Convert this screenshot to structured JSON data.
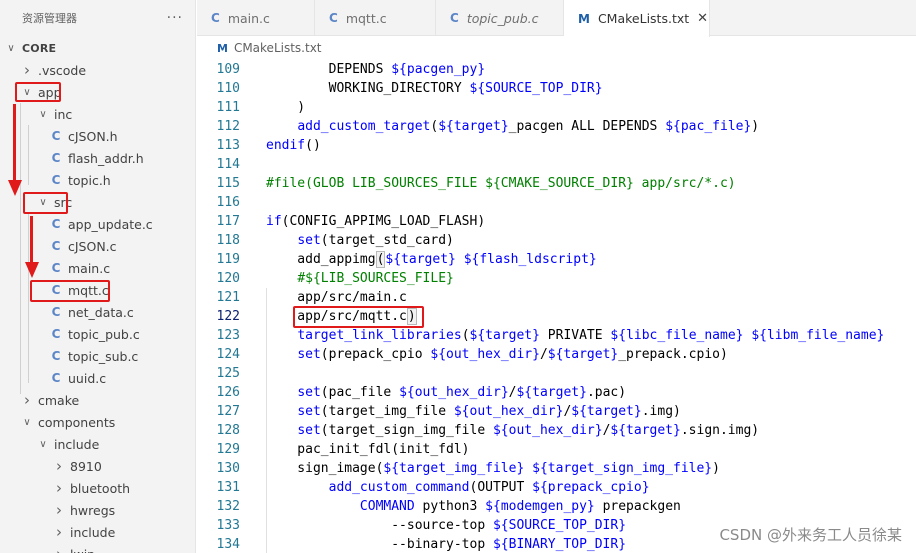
{
  "sidebar": {
    "title": "资源管理器",
    "more": "···",
    "tree": [
      {
        "label": "CORE",
        "kind": "folder-open",
        "depth": 0,
        "bold": true
      },
      {
        "label": ".vscode",
        "kind": "folder",
        "depth": 1
      },
      {
        "label": "app",
        "kind": "folder-open",
        "depth": 1
      },
      {
        "label": "inc",
        "kind": "folder-open",
        "depth": 2
      },
      {
        "label": "cJSON.h",
        "kind": "file",
        "depth": 3
      },
      {
        "label": "flash_addr.h",
        "kind": "file",
        "depth": 3
      },
      {
        "label": "topic.h",
        "kind": "file",
        "depth": 3
      },
      {
        "label": "src",
        "kind": "folder-open",
        "depth": 2
      },
      {
        "label": "app_update.c",
        "kind": "file",
        "depth": 3
      },
      {
        "label": "cJSON.c",
        "kind": "file",
        "depth": 3
      },
      {
        "label": "main.c",
        "kind": "file",
        "depth": 3
      },
      {
        "label": "mqtt.c",
        "kind": "file",
        "depth": 3
      },
      {
        "label": "net_data.c",
        "kind": "file",
        "depth": 3
      },
      {
        "label": "topic_pub.c",
        "kind": "file",
        "depth": 3
      },
      {
        "label": "topic_sub.c",
        "kind": "file",
        "depth": 3
      },
      {
        "label": "uuid.c",
        "kind": "file",
        "depth": 3
      },
      {
        "label": "cmake",
        "kind": "folder",
        "depth": 1
      },
      {
        "label": "components",
        "kind": "folder-open",
        "depth": 1
      },
      {
        "label": "include",
        "kind": "folder-open",
        "depth": 2
      },
      {
        "label": "8910",
        "kind": "folder",
        "depth": 3
      },
      {
        "label": "bluetooth",
        "kind": "folder",
        "depth": 3
      },
      {
        "label": "hwregs",
        "kind": "folder",
        "depth": 3
      },
      {
        "label": "include",
        "kind": "folder",
        "depth": 3
      },
      {
        "label": "lwip",
        "kind": "folder",
        "depth": 3
      }
    ]
  },
  "tabs": [
    {
      "label": "main.c",
      "icon": "C",
      "active": false,
      "italic": false
    },
    {
      "label": "mqtt.c",
      "icon": "C",
      "active": false,
      "italic": false
    },
    {
      "label": "topic_pub.c",
      "icon": "C",
      "active": false,
      "italic": true
    },
    {
      "label": "CMakeLists.txt",
      "icon": "M",
      "active": true,
      "italic": false,
      "close": "✕"
    }
  ],
  "breadcrumb": {
    "icon": "M",
    "label": "CMakeLists.txt"
  },
  "current_line": 122,
  "code": [
    {
      "n": 109,
      "segs": [
        [
          "pl",
          "        DEPENDS "
        ],
        [
          "var",
          "${pacgen_py}"
        ]
      ]
    },
    {
      "n": 110,
      "segs": [
        [
          "pl",
          "        WORKING_DIRECTORY "
        ],
        [
          "var",
          "${SOURCE_TOP_DIR}"
        ]
      ]
    },
    {
      "n": 111,
      "segs": [
        [
          "pl",
          "    )"
        ]
      ]
    },
    {
      "n": 112,
      "segs": [
        [
          "pl",
          "    "
        ],
        [
          "fn",
          "add_custom_target"
        ],
        [
          "pl",
          "("
        ],
        [
          "var",
          "${target}"
        ],
        [
          "pl",
          "_pacgen ALL DEPENDS "
        ],
        [
          "var",
          "${pac_file}"
        ],
        [
          "pl",
          ")"
        ]
      ]
    },
    {
      "n": 113,
      "segs": [
        [
          "fn",
          "endif"
        ],
        [
          "pl",
          "()"
        ]
      ]
    },
    {
      "n": 114,
      "segs": []
    },
    {
      "n": 115,
      "segs": [
        [
          "cm",
          "#file(GLOB LIB_SOURCES_FILE ${CMAKE_SOURCE_DIR} app/src/*.c)"
        ]
      ]
    },
    {
      "n": 116,
      "segs": []
    },
    {
      "n": 117,
      "segs": [
        [
          "fn",
          "if"
        ],
        [
          "pl",
          "(CONFIG_APPIMG_LOAD_FLASH)"
        ]
      ]
    },
    {
      "n": 118,
      "segs": [
        [
          "pl",
          "    "
        ],
        [
          "fn",
          "set"
        ],
        [
          "pl",
          "(target_std_card)"
        ]
      ]
    },
    {
      "n": 119,
      "segs": [
        [
          "pl",
          "    add_appimg"
        ],
        [
          "match",
          "("
        ],
        [
          "var",
          "${target}"
        ],
        [
          "pl",
          " "
        ],
        [
          "var",
          "${flash_ldscript}"
        ]
      ]
    },
    {
      "n": 120,
      "segs": [
        [
          "pl",
          "    "
        ],
        [
          "cm",
          "#${LIB_SOURCES_FILE}"
        ]
      ]
    },
    {
      "n": 121,
      "segs": [
        [
          "pl",
          "    app/src/main.c"
        ]
      ]
    },
    {
      "n": 122,
      "segs": [
        [
          "pl",
          "    app/src/mqtt.c"
        ],
        [
          "match",
          ")"
        ]
      ]
    },
    {
      "n": 123,
      "segs": [
        [
          "pl",
          "    "
        ],
        [
          "fn",
          "target_link_libraries"
        ],
        [
          "pl",
          "("
        ],
        [
          "var",
          "${target}"
        ],
        [
          "pl",
          " PRIVATE "
        ],
        [
          "var",
          "${libc_file_name}"
        ],
        [
          "pl",
          " "
        ],
        [
          "var",
          "${libm_file_name}"
        ]
      ]
    },
    {
      "n": 124,
      "segs": [
        [
          "pl",
          "    "
        ],
        [
          "fn",
          "set"
        ],
        [
          "pl",
          "(prepack_cpio "
        ],
        [
          "var",
          "${out_hex_dir}"
        ],
        [
          "pl",
          "/"
        ],
        [
          "var",
          "${target}"
        ],
        [
          "pl",
          "_prepack.cpio)"
        ]
      ]
    },
    {
      "n": 125,
      "segs": []
    },
    {
      "n": 126,
      "segs": [
        [
          "pl",
          "    "
        ],
        [
          "fn",
          "set"
        ],
        [
          "pl",
          "(pac_file "
        ],
        [
          "var",
          "${out_hex_dir}"
        ],
        [
          "pl",
          "/"
        ],
        [
          "var",
          "${target}"
        ],
        [
          "pl",
          ".pac)"
        ]
      ]
    },
    {
      "n": 127,
      "segs": [
        [
          "pl",
          "    "
        ],
        [
          "fn",
          "set"
        ],
        [
          "pl",
          "(target_img_file "
        ],
        [
          "var",
          "${out_hex_dir}"
        ],
        [
          "pl",
          "/"
        ],
        [
          "var",
          "${target}"
        ],
        [
          "pl",
          ".img)"
        ]
      ]
    },
    {
      "n": 128,
      "segs": [
        [
          "pl",
          "    "
        ],
        [
          "fn",
          "set"
        ],
        [
          "pl",
          "(target_sign_img_file "
        ],
        [
          "var",
          "${out_hex_dir}"
        ],
        [
          "pl",
          "/"
        ],
        [
          "var",
          "${target}"
        ],
        [
          "pl",
          ".sign.img)"
        ]
      ]
    },
    {
      "n": 129,
      "segs": [
        [
          "pl",
          "    pac_init_fdl(init_fdl)"
        ]
      ]
    },
    {
      "n": 130,
      "segs": [
        [
          "pl",
          "    sign_image("
        ],
        [
          "var",
          "${target_img_file}"
        ],
        [
          "pl",
          " "
        ],
        [
          "var",
          "${target_sign_img_file}"
        ],
        [
          "pl",
          ")"
        ]
      ]
    },
    {
      "n": 131,
      "segs": [
        [
          "pl",
          "        "
        ],
        [
          "fn",
          "add_custom_command"
        ],
        [
          "pl",
          "(OUTPUT "
        ],
        [
          "var",
          "${prepack_cpio}"
        ]
      ]
    },
    {
      "n": 132,
      "segs": [
        [
          "pl",
          "            "
        ],
        [
          "fn",
          "COMMAND"
        ],
        [
          "pl",
          " python3 "
        ],
        [
          "var",
          "${modemgen_py}"
        ],
        [
          "pl",
          " prepackgen"
        ]
      ]
    },
    {
      "n": 133,
      "segs": [
        [
          "pl",
          "                --source-top "
        ],
        [
          "var",
          "${SOURCE_TOP_DIR}"
        ]
      ]
    },
    {
      "n": 134,
      "segs": [
        [
          "pl",
          "                --binary-top "
        ],
        [
          "var",
          "${BINARY_TOP_DIR}"
        ]
      ]
    }
  ],
  "watermark": "CSDN @外来务工人员徐某",
  "colors": {
    "highlight": "#e0191b",
    "keyword": "#0000ff",
    "comment": "#008000",
    "line_number": "#237893",
    "c_icon": "#5c86c7"
  }
}
